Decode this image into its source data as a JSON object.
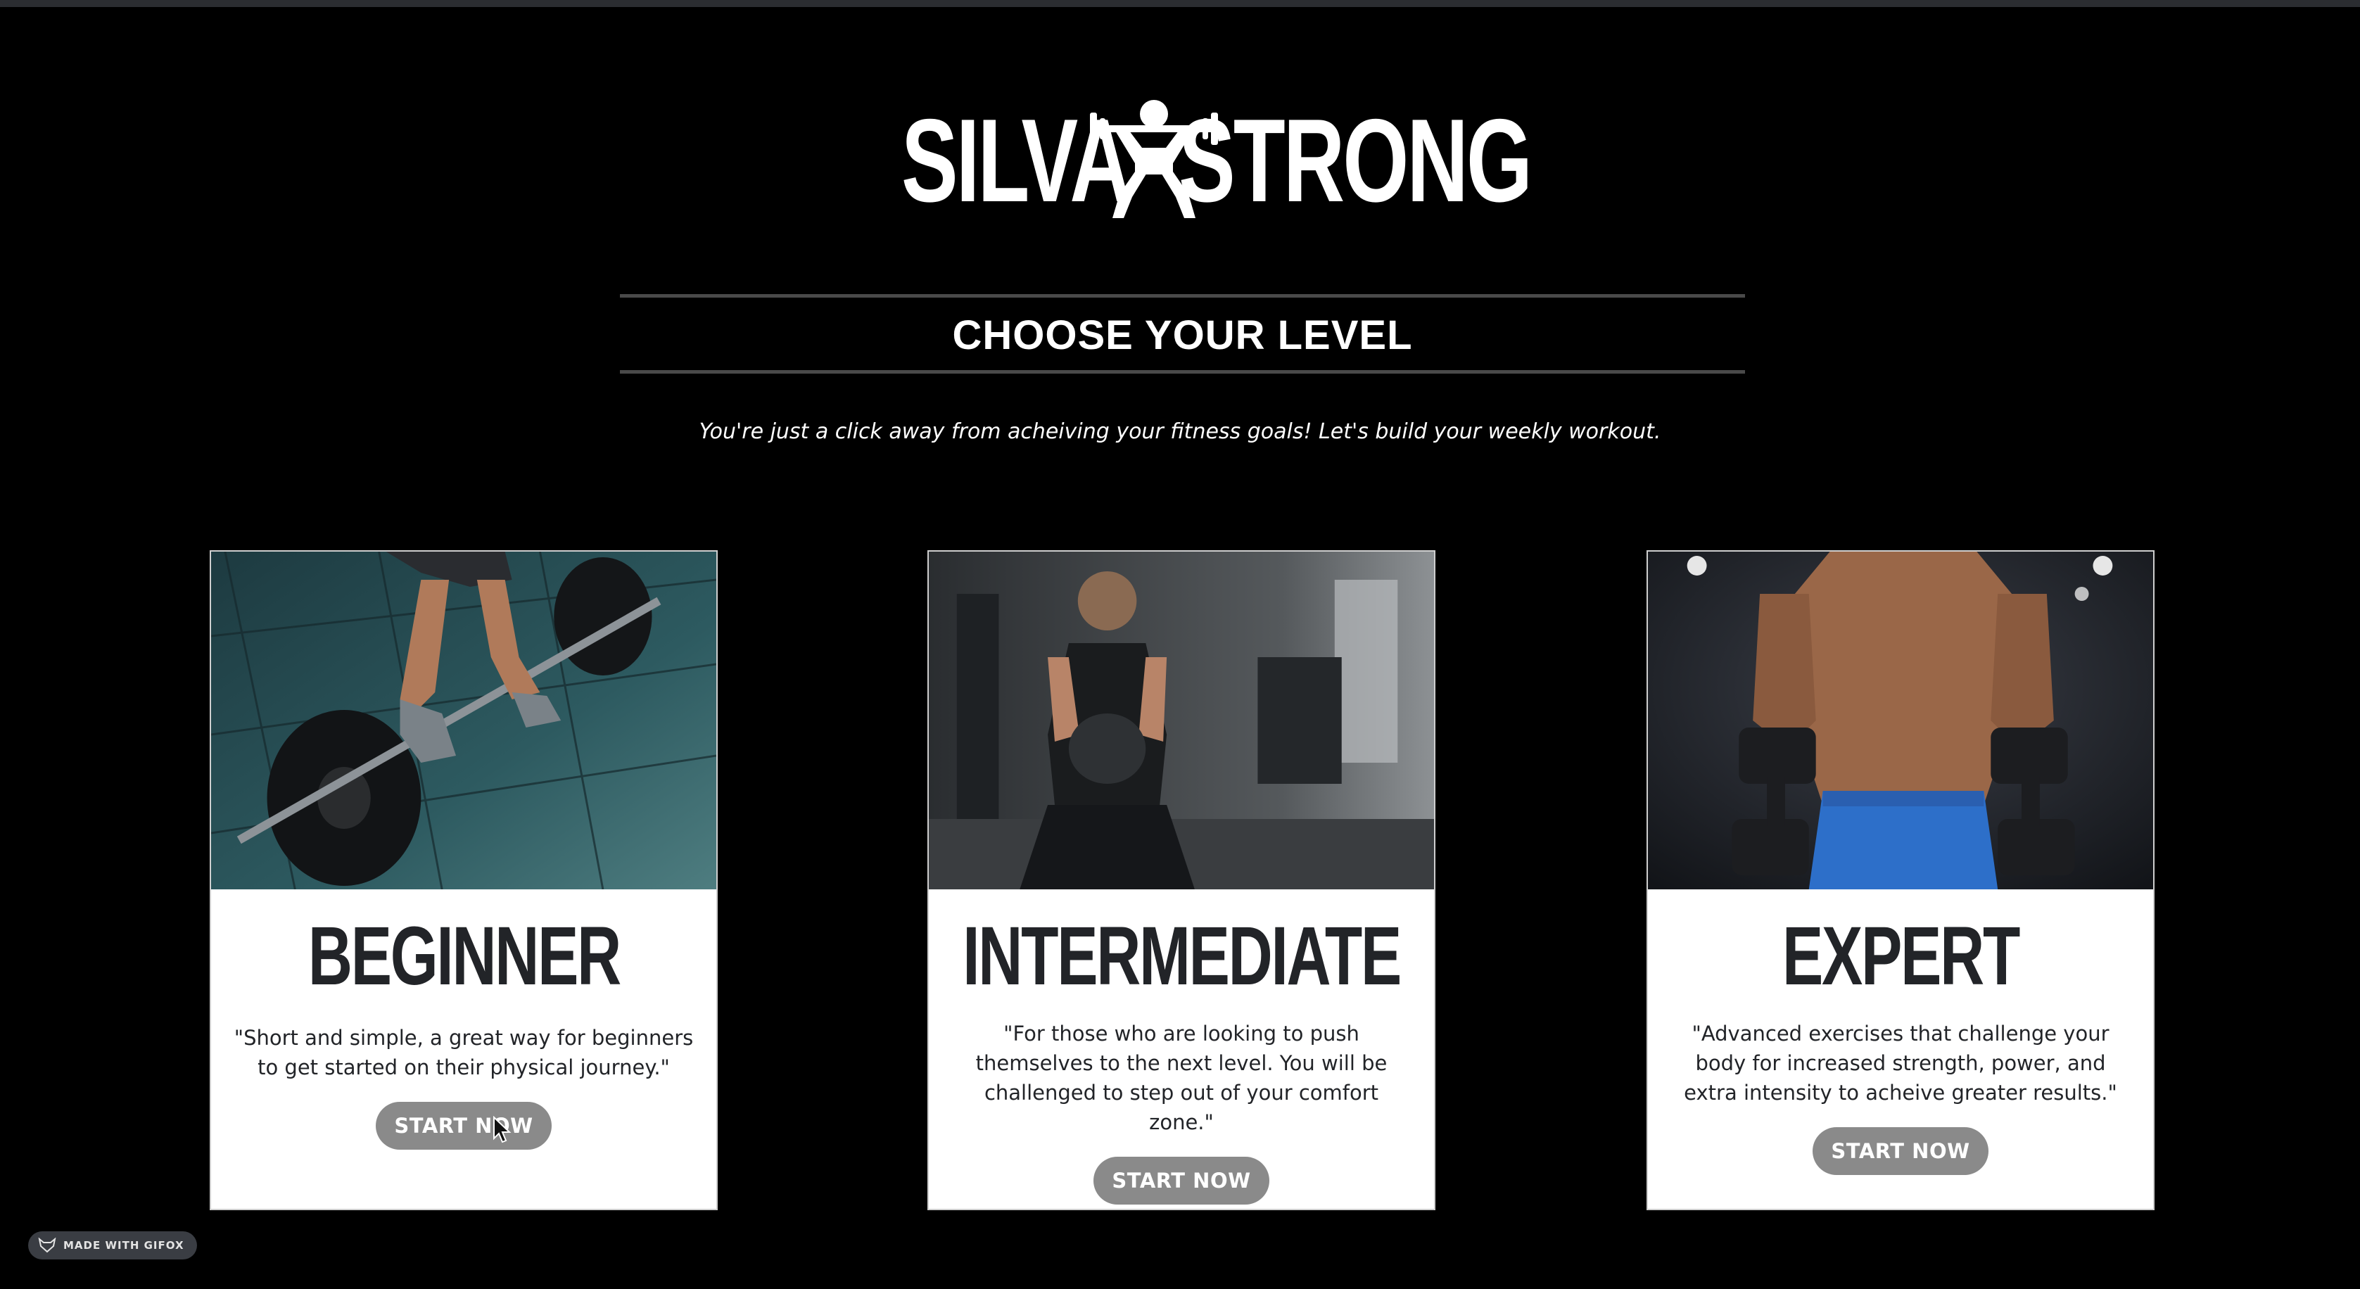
{
  "brand": {
    "left_word": "SILVA",
    "right_word": "STRONG",
    "icon": "weightlifter-icon"
  },
  "heading": "CHOOSE YOUR LEVEL",
  "subtitle": "You're just a click away from acheiving your fitness goals! Let's build your weekly workout.",
  "cards": [
    {
      "title": "BEGINNER",
      "description": "\"Short and simple, a great way for beginners to get started on their physical journey.\"",
      "button": "START NOW",
      "image": "barbell-deadlift-photo"
    },
    {
      "title": "INTERMEDIATE",
      "description": "\"For those who are looking to push themselves to the next level. You will be challenged to step out of your comfort zone.\"",
      "button": "START NOW",
      "image": "kettlebell-squat-photo"
    },
    {
      "title": "EXPERT",
      "description": "\"Advanced exercises that challenge your body for increased strength, power, and extra intensity to acheive greater results.\"",
      "button": "START NOW",
      "image": "dumbbell-bodybuilder-photo"
    }
  ],
  "badge": {
    "label": "MADE WITH GIFOX",
    "icon": "fox-icon"
  },
  "colors": {
    "background": "#000000",
    "card": "#ffffff",
    "button": "#8a8a8a",
    "title_text": "#222428"
  }
}
